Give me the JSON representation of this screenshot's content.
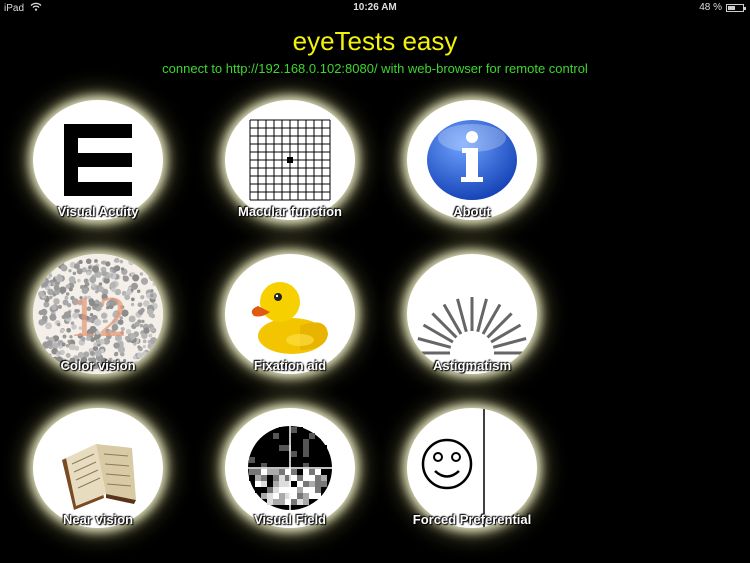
{
  "status_bar": {
    "device": "iPad",
    "time": "10:26 AM",
    "battery_percent": "48 %",
    "battery_level": 0.48,
    "wifi_icon": "wifi-icon",
    "battery_icon": "battery-icon"
  },
  "header": {
    "title": "eyeTests easy",
    "subtitle": "connect to http://192.168.0.102:8080/ with web-browser for remote control"
  },
  "colors": {
    "title": "#f2f20a",
    "subtitle": "#3dd62e",
    "background": "#000000"
  },
  "tests": [
    {
      "label": "Visual Acuity",
      "icon": "letter-e-icon"
    },
    {
      "label": "Macular function",
      "icon": "amsler-grid-icon"
    },
    {
      "label": "About",
      "icon": "info-icon"
    },
    {
      "label": "Color vision",
      "icon": "ishihara-plate-icon"
    },
    {
      "label": "Fixation aid",
      "icon": "rubber-duck-icon"
    },
    {
      "label": "Astigmatism",
      "icon": "astigmatism-fan-icon"
    },
    {
      "label": "Near vision",
      "icon": "open-book-icon"
    },
    {
      "label": "Visual Field",
      "icon": "visual-field-map-icon"
    },
    {
      "label": "Forced Preferential",
      "icon": "smiley-face-icon"
    }
  ]
}
